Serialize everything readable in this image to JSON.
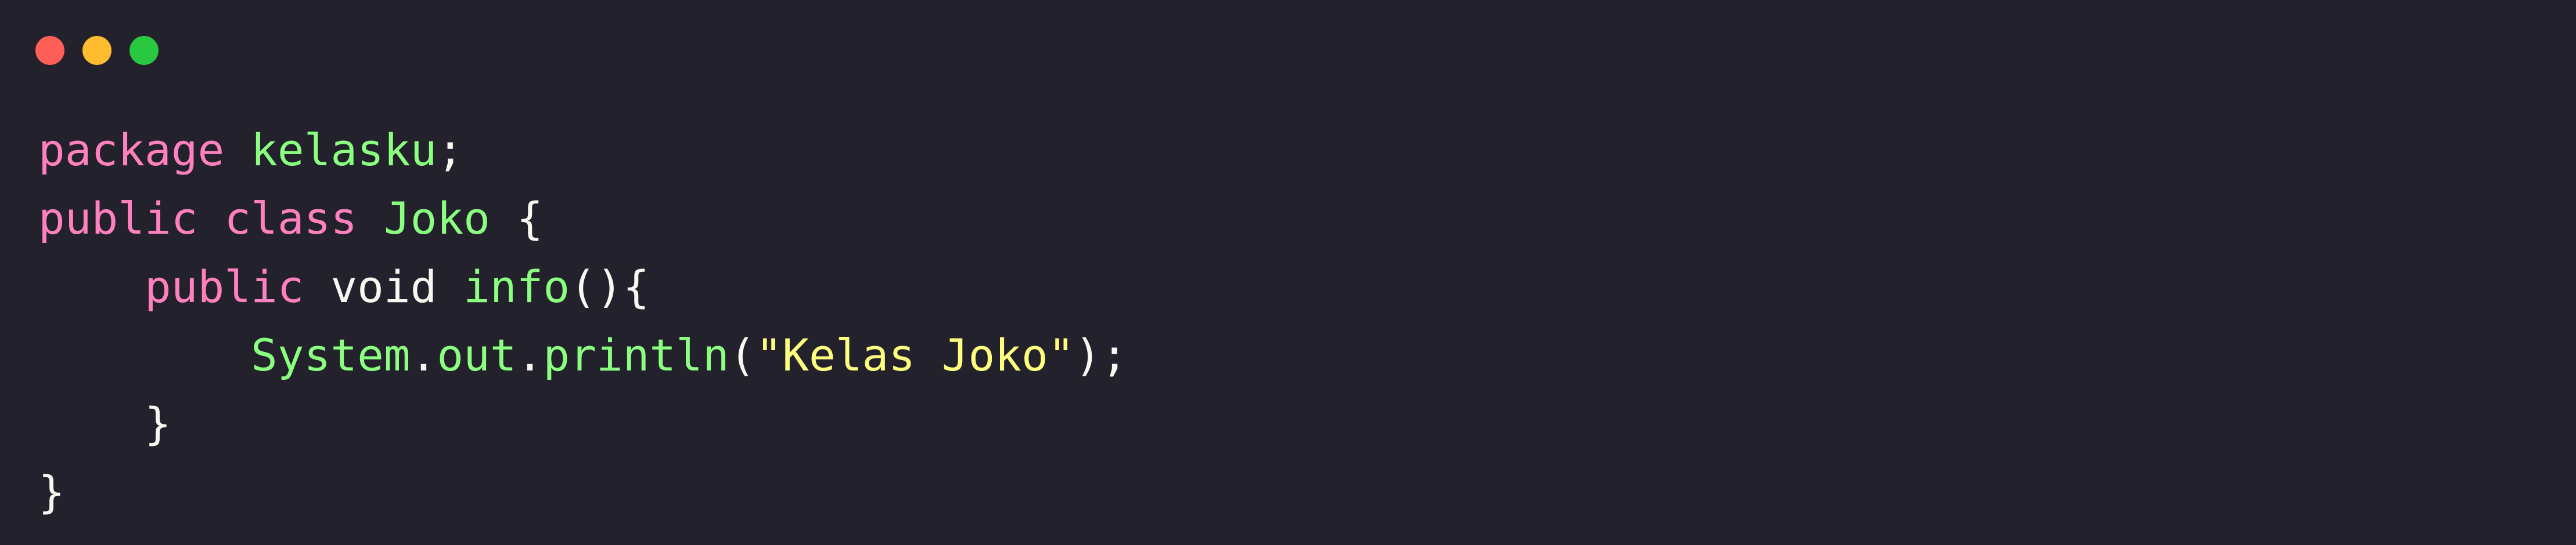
{
  "window": {
    "traffic_lights": [
      {
        "name": "close-dot",
        "color": "#ff5f57"
      },
      {
        "name": "minimize-dot",
        "color": "#febc2e"
      },
      {
        "name": "zoom-dot",
        "color": "#28c840"
      }
    ]
  },
  "colors": {
    "background": "#22212c",
    "keyword": "#ff80bf",
    "identifier": "#8aff80",
    "plain": "#f8f8f2",
    "string": "#ffff80"
  },
  "code": {
    "lines": [
      {
        "tokens": [
          {
            "text": "package",
            "kind": "keyword"
          },
          {
            "text": " ",
            "kind": "plain"
          },
          {
            "text": "kelasku",
            "kind": "identifier"
          },
          {
            "text": ";",
            "kind": "plain"
          }
        ]
      },
      {
        "tokens": [
          {
            "text": "public",
            "kind": "keyword"
          },
          {
            "text": " ",
            "kind": "plain"
          },
          {
            "text": "class",
            "kind": "keyword"
          },
          {
            "text": " ",
            "kind": "plain"
          },
          {
            "text": "Joko",
            "kind": "identifier"
          },
          {
            "text": " {",
            "kind": "plain"
          }
        ]
      },
      {
        "tokens": [
          {
            "text": "    ",
            "kind": "plain"
          },
          {
            "text": "public",
            "kind": "keyword"
          },
          {
            "text": " void ",
            "kind": "plain"
          },
          {
            "text": "info",
            "kind": "identifier"
          },
          {
            "text": "(){",
            "kind": "plain"
          }
        ]
      },
      {
        "tokens": [
          {
            "text": "        ",
            "kind": "plain"
          },
          {
            "text": "System",
            "kind": "identifier"
          },
          {
            "text": ".",
            "kind": "plain"
          },
          {
            "text": "out",
            "kind": "identifier"
          },
          {
            "text": ".",
            "kind": "plain"
          },
          {
            "text": "println",
            "kind": "identifier"
          },
          {
            "text": "(",
            "kind": "plain"
          },
          {
            "text": "\"Kelas Joko\"",
            "kind": "string"
          },
          {
            "text": ");",
            "kind": "plain"
          }
        ]
      },
      {
        "tokens": [
          {
            "text": "    }",
            "kind": "plain"
          }
        ]
      },
      {
        "tokens": [
          {
            "text": "}",
            "kind": "plain"
          }
        ]
      }
    ]
  }
}
